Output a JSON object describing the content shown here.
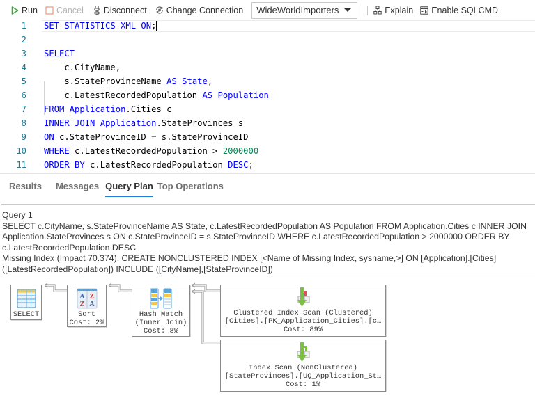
{
  "toolbar": {
    "run_label": "Run",
    "cancel_label": "Cancel",
    "disconnect_label": "Disconnect",
    "change_connection_label": "Change Connection",
    "database_selected": "WideWorldImporters",
    "explain_label": "Explain",
    "enable_sqlcmd_label": "Enable SQLCMD",
    "icons": {
      "run": "play-icon",
      "cancel": "stop-square-icon",
      "disconnect": "plug-icon",
      "change_connection": "refresh-connection-icon",
      "explain": "hierarchy-icon",
      "enable_sqlcmd": "sqlcmd-icon"
    }
  },
  "editor": {
    "current_line": 1,
    "lines": [
      {
        "num": "1",
        "tokens": [
          {
            "t": "SET STATISTICS XML ON",
            "c": "kw"
          },
          {
            "t": ";",
            "c": ""
          }
        ]
      },
      {
        "num": "2",
        "tokens": []
      },
      {
        "num": "3",
        "tokens": [
          {
            "t": "SELECT",
            "c": "kw"
          }
        ]
      },
      {
        "num": "4",
        "tokens": [
          {
            "t": "    c.CityName,",
            "c": ""
          }
        ]
      },
      {
        "num": "5",
        "tokens": [
          {
            "t": "    s.StateProvinceName ",
            "c": ""
          },
          {
            "t": "AS",
            "c": "kw"
          },
          {
            "t": " ",
            "c": ""
          },
          {
            "t": "State",
            "c": "kw"
          },
          {
            "t": ",",
            "c": ""
          }
        ]
      },
      {
        "num": "6",
        "tokens": [
          {
            "t": "    c.LatestRecordedPopulation ",
            "c": ""
          },
          {
            "t": "AS",
            "c": "kw"
          },
          {
            "t": " ",
            "c": ""
          },
          {
            "t": "Population",
            "c": "kw"
          }
        ]
      },
      {
        "num": "7",
        "tokens": [
          {
            "t": "FROM",
            "c": "kw"
          },
          {
            "t": " ",
            "c": ""
          },
          {
            "t": "Application",
            "c": "kw"
          },
          {
            "t": ".Cities c",
            "c": ""
          }
        ]
      },
      {
        "num": "8",
        "tokens": [
          {
            "t": "INNER JOIN",
            "c": "kw"
          },
          {
            "t": " ",
            "c": ""
          },
          {
            "t": "Application",
            "c": "kw"
          },
          {
            "t": ".StateProvinces s",
            "c": ""
          }
        ]
      },
      {
        "num": "9",
        "tokens": [
          {
            "t": "ON",
            "c": "kw"
          },
          {
            "t": " c.StateProvinceID = s.StateProvinceID",
            "c": ""
          }
        ]
      },
      {
        "num": "10",
        "tokens": [
          {
            "t": "WHERE",
            "c": "kw"
          },
          {
            "t": " c.LatestRecordedPopulation > ",
            "c": ""
          },
          {
            "t": "2000000",
            "c": "num"
          }
        ]
      },
      {
        "num": "11",
        "tokens": [
          {
            "t": "ORDER BY",
            "c": "kw"
          },
          {
            "t": " c.LatestRecordedPopulation ",
            "c": ""
          },
          {
            "t": "DESC",
            "c": "kw"
          },
          {
            "t": ";",
            "c": ""
          }
        ]
      }
    ]
  },
  "results": {
    "tabs": [
      {
        "label": "Results",
        "active": false
      },
      {
        "label": "Messages",
        "active": false
      },
      {
        "label": "Query Plan",
        "active": true
      },
      {
        "label": "Top Operations",
        "active": false
      }
    ],
    "accent_color": "#1b7fdb",
    "query_title": "Query 1",
    "query_text": "SELECT c.CityName, s.StateProvinceName AS State, c.LatestRecordedPopulation AS Population FROM Application.Cities c INNER JOIN Application.StateProvinces s ON c.StateProvinceID = s.StateProvinceID WHERE c.LatestRecordedPopulation > 2000000 ORDER BY c.LatestRecordedPopulation DESC",
    "missing_index": "Missing Index (Impact 70.374): CREATE NONCLUSTERED INDEX [<Name of Missing Index, sysname,>] ON [Application].[Cities] ([LatestRecordedPopulation]) INCLUDE ([CityName],[StateProvinceID])"
  },
  "plan": {
    "nodes": {
      "select": {
        "icon": "result-table-icon",
        "lines": [
          "SELECT"
        ]
      },
      "sort": {
        "icon": "sort-az-icon",
        "lines": [
          "Sort",
          "Cost: 2%"
        ]
      },
      "hash": {
        "icon": "hash-match-icon",
        "lines": [
          "Hash Match",
          "(Inner Join)",
          "Cost: 8%"
        ]
      },
      "clustered_index_scan": {
        "icon": "clustered-index-scan-icon",
        "lines": [
          "Clustered Index Scan (Clustered)",
          "[Cities].[PK_Application_Cities].[c…",
          "Cost: 89%"
        ]
      },
      "index_scan": {
        "icon": "index-scan-icon",
        "lines": [
          "Index Scan (NonClustered)",
          "[StateProvinces].[UQ_Application_St…",
          "Cost: 1%"
        ]
      }
    }
  }
}
